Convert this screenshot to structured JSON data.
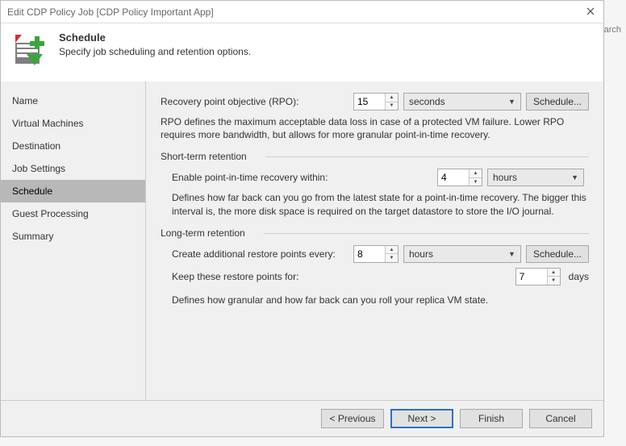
{
  "window": {
    "title": "Edit CDP Policy Job [CDP Policy Important App]"
  },
  "header": {
    "title": "Schedule",
    "subtitle": "Specify job scheduling and retention options."
  },
  "sidebar": {
    "items": [
      {
        "label": "Name"
      },
      {
        "label": "Virtual Machines"
      },
      {
        "label": "Destination"
      },
      {
        "label": "Job Settings"
      },
      {
        "label": "Schedule",
        "selected": true
      },
      {
        "label": "Guest Processing"
      },
      {
        "label": "Summary"
      }
    ]
  },
  "rpo": {
    "label": "Recovery point objective (RPO):",
    "value": "15",
    "unit": "seconds",
    "schedule_btn": "Schedule...",
    "desc": "RPO defines the maximum acceptable data loss in case of a protected VM failure. Lower RPO requires more bandwidth, but allows for more granular point-in-time recovery."
  },
  "short_term": {
    "title": "Short-term retention",
    "label": "Enable point-in-time recovery within:",
    "value": "4",
    "unit": "hours",
    "desc": "Defines how far back can you go from the latest state for a point-in-time recovery. The bigger this interval is, the more disk space is required on the target datastore to store the I/O journal."
  },
  "long_term": {
    "title": "Long-term retention",
    "create_label": "Create additional restore points every:",
    "create_value": "8",
    "create_unit": "hours",
    "schedule_btn": "Schedule...",
    "keep_label": "Keep these restore points for:",
    "keep_value": "7",
    "keep_unit": "days",
    "desc": "Defines how granular and how far back can you roll your replica VM state."
  },
  "footer": {
    "previous": "< Previous",
    "next": "Next >",
    "finish": "Finish",
    "cancel": "Cancel"
  },
  "off": {
    "arch": "arch"
  }
}
